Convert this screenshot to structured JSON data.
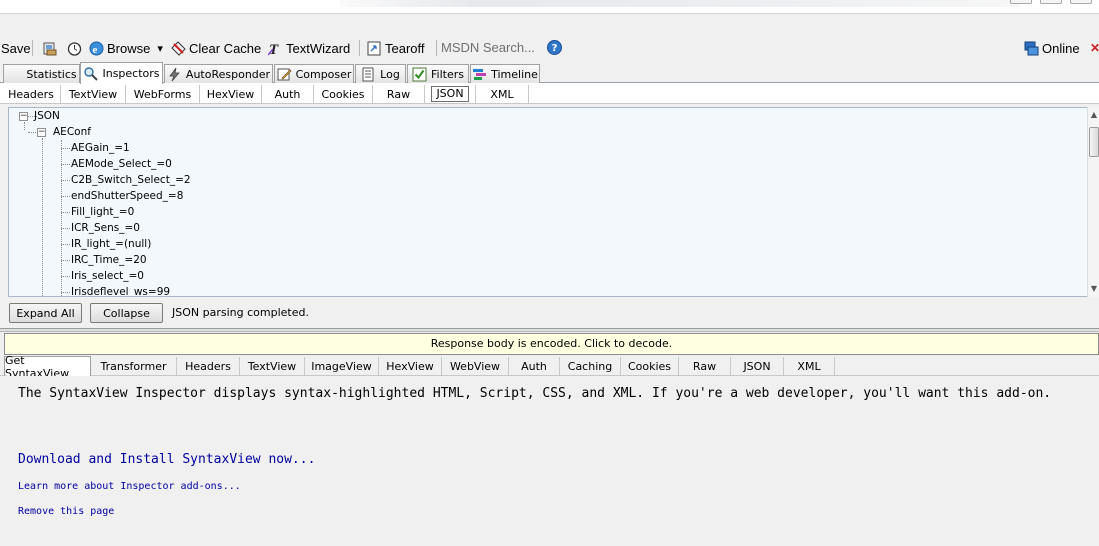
{
  "toolbar": {
    "save_label": "Save",
    "browse_label": "Browse",
    "clear_cache_label": "Clear Cache",
    "textwizard_label": "TextWizard",
    "tearoff_label": "Tearoff",
    "search_placeholder": "MSDN Search...",
    "help_glyph": "?",
    "online_label": "Online",
    "close_glyph": "✕",
    "dropdown_glyph": "▾"
  },
  "main_tabs": [
    {
      "label": "Statistics",
      "icon": "statistics-icon"
    },
    {
      "label": "Inspectors",
      "icon": "inspectors-icon"
    },
    {
      "label": "AutoResponder",
      "icon": "lightning-icon"
    },
    {
      "label": "Composer",
      "icon": "composer-icon"
    },
    {
      "label": "Log",
      "icon": "log-icon"
    },
    {
      "label": "Filters",
      "icon": "checkbox-icon"
    },
    {
      "label": "Timeline",
      "icon": "timeline-icon"
    }
  ],
  "request_tabs": [
    "Headers",
    "TextView",
    "WebForms",
    "HexView",
    "Auth",
    "Cookies",
    "Raw",
    "JSON",
    "XML"
  ],
  "tree": {
    "root": "JSON",
    "node": "AEConf",
    "expand_glyph": "−",
    "items": [
      "AEGain_=1",
      "AEMode_Select_=0",
      "C2B_Switch_Select_=2",
      "endShutterSpeed_=8",
      "Fill_light_=0",
      "ICR_Sens_=0",
      "IR_light_=(null)",
      "IRC_Time_=20",
      "Iris_select_=0",
      "Irisdeflevel_ws=99"
    ],
    "scroll_up": "▲",
    "scroll_down": "▼"
  },
  "json_actions": {
    "expand_all": "Expand All",
    "collapse": "Collapse",
    "status": "JSON parsing completed."
  },
  "banner": "Response body is encoded. Click to decode.",
  "response_tabs": [
    "Get SyntaxView",
    "Transformer",
    "Headers",
    "TextView",
    "ImageView",
    "HexView",
    "WebView",
    "Auth",
    "Caching",
    "Cookies",
    "Raw",
    "JSON",
    "XML"
  ],
  "syntaxview": {
    "description": "The SyntaxView Inspector displays syntax-highlighted HTML, Script, CSS, and XML. If you're a web developer, you'll want this add-on.",
    "download_link": "Download and Install SyntaxView now...",
    "learn_more_link": "Learn more about Inspector add-ons...",
    "remove_link": "Remove this page"
  },
  "colors": {
    "link": "#0000a0",
    "banner_bg": "#ffffe1",
    "tree_bg": "#f2f8fc",
    "help_icon": "#2f75c8",
    "close_red": "#cc2020"
  }
}
